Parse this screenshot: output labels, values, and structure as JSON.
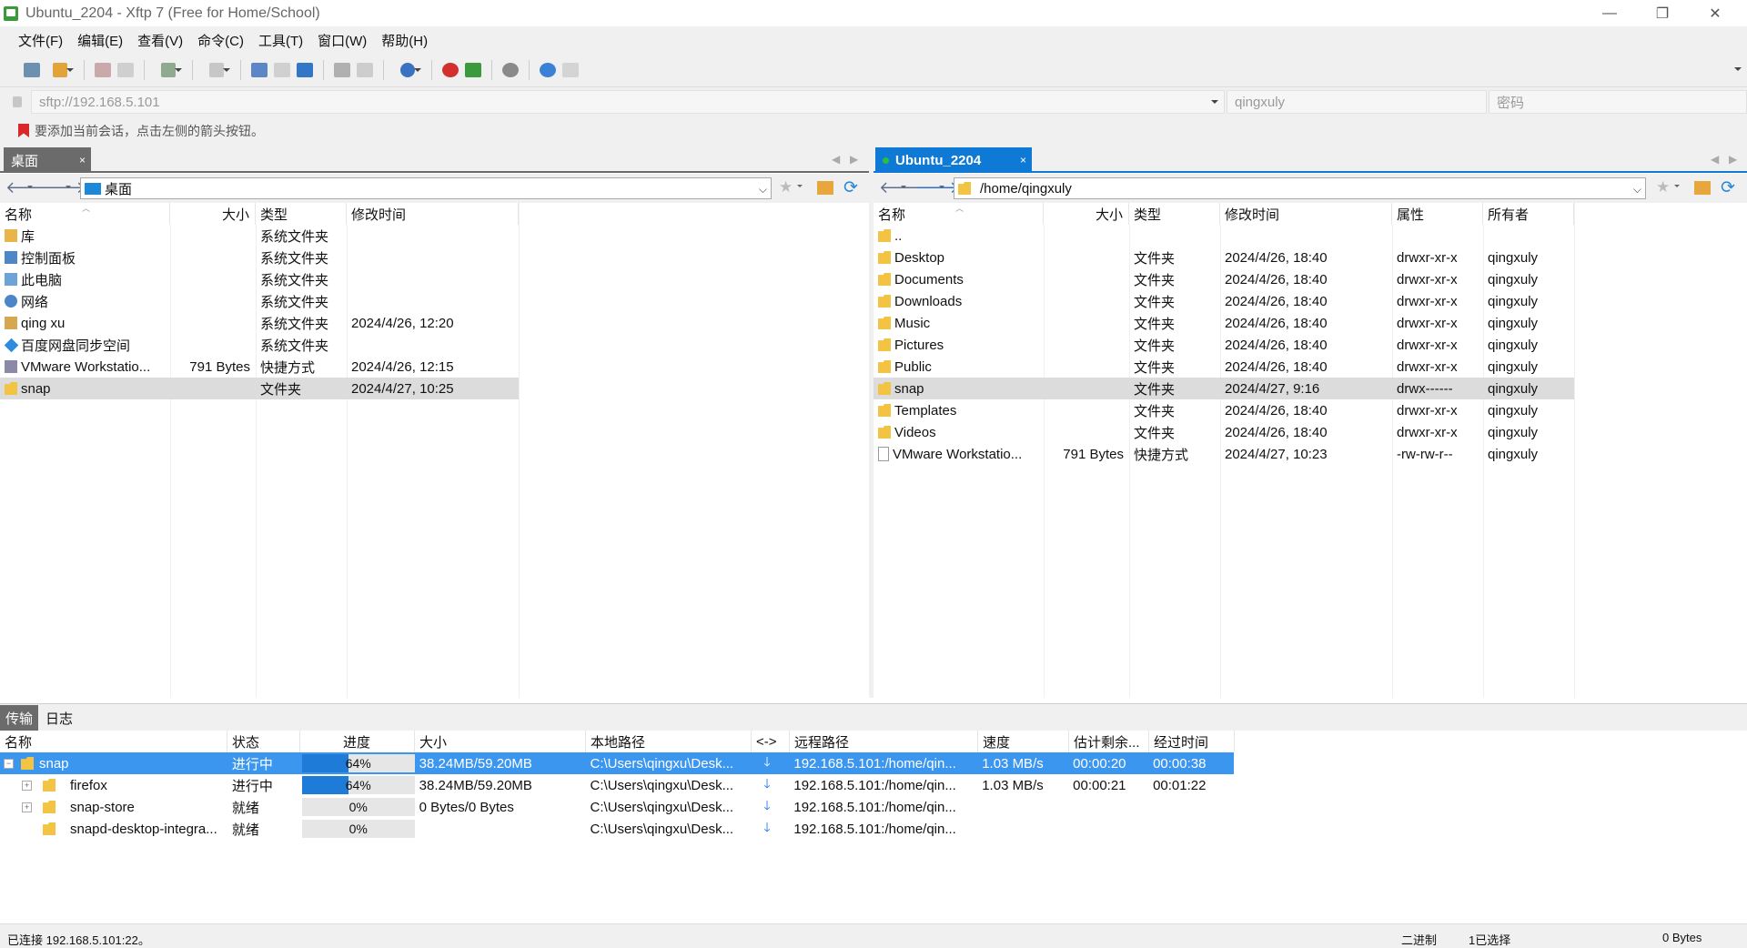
{
  "window": {
    "title": "Ubuntu_2204 - Xftp 7 (Free for Home/School)"
  },
  "menu": [
    "文件(F)",
    "编辑(E)",
    "查看(V)",
    "命令(C)",
    "工具(T)",
    "窗口(W)",
    "帮助(H)"
  ],
  "address": {
    "url": "sftp://192.168.5.101",
    "username": "qingxuly",
    "password_placeholder": "密码"
  },
  "hint": "要添加当前会话，点击左侧的箭头按钮。",
  "left_pane": {
    "tab": "桌面",
    "path": "桌面",
    "columns": [
      "名称",
      "大小",
      "类型",
      "修改时间"
    ],
    "rows": [
      {
        "name": "库",
        "size": "",
        "type": "系统文件夹",
        "modified": "",
        "icon": "library-icon"
      },
      {
        "name": "控制面板",
        "size": "",
        "type": "系统文件夹",
        "modified": "",
        "icon": "control-panel-icon"
      },
      {
        "name": "此电脑",
        "size": "",
        "type": "系统文件夹",
        "modified": "",
        "icon": "computer-icon"
      },
      {
        "name": "网络",
        "size": "",
        "type": "系统文件夹",
        "modified": "",
        "icon": "network-icon"
      },
      {
        "name": "qing xu",
        "size": "",
        "type": "系统文件夹",
        "modified": "2024/4/26, 12:20",
        "icon": "user-folder-icon"
      },
      {
        "name": "百度网盘同步空间",
        "size": "",
        "type": "系统文件夹",
        "modified": "",
        "icon": "baidu-netdisk-icon"
      },
      {
        "name": "VMware Workstatio...",
        "size": "791 Bytes",
        "type": "快捷方式",
        "modified": "2024/4/26, 12:15",
        "icon": "vmware-icon"
      },
      {
        "name": "snap",
        "size": "",
        "type": "文件夹",
        "modified": "2024/4/27, 10:25",
        "icon": "folder-icon"
      }
    ]
  },
  "right_pane": {
    "tab": "Ubuntu_2204",
    "path": "/home/qingxuly",
    "columns": [
      "名称",
      "大小",
      "类型",
      "修改时间",
      "属性",
      "所有者"
    ],
    "rows": [
      {
        "name": "..",
        "size": "",
        "type": "",
        "modified": "",
        "attr": "",
        "owner": "",
        "icon": "folder-icon"
      },
      {
        "name": "Desktop",
        "size": "",
        "type": "文件夹",
        "modified": "2024/4/26, 18:40",
        "attr": "drwxr-xr-x",
        "owner": "qingxuly",
        "icon": "folder-icon"
      },
      {
        "name": "Documents",
        "size": "",
        "type": "文件夹",
        "modified": "2024/4/26, 18:40",
        "attr": "drwxr-xr-x",
        "owner": "qingxuly",
        "icon": "folder-icon"
      },
      {
        "name": "Downloads",
        "size": "",
        "type": "文件夹",
        "modified": "2024/4/26, 18:40",
        "attr": "drwxr-xr-x",
        "owner": "qingxuly",
        "icon": "folder-icon"
      },
      {
        "name": "Music",
        "size": "",
        "type": "文件夹",
        "modified": "2024/4/26, 18:40",
        "attr": "drwxr-xr-x",
        "owner": "qingxuly",
        "icon": "folder-icon"
      },
      {
        "name": "Pictures",
        "size": "",
        "type": "文件夹",
        "modified": "2024/4/26, 18:40",
        "attr": "drwxr-xr-x",
        "owner": "qingxuly",
        "icon": "folder-icon"
      },
      {
        "name": "Public",
        "size": "",
        "type": "文件夹",
        "modified": "2024/4/26, 18:40",
        "attr": "drwxr-xr-x",
        "owner": "qingxuly",
        "icon": "folder-icon"
      },
      {
        "name": "snap",
        "size": "",
        "type": "文件夹",
        "modified": "2024/4/27, 9:16",
        "attr": "drwx------",
        "owner": "qingxuly",
        "icon": "folder-icon"
      },
      {
        "name": "Templates",
        "size": "",
        "type": "文件夹",
        "modified": "2024/4/26, 18:40",
        "attr": "drwxr-xr-x",
        "owner": "qingxuly",
        "icon": "folder-icon"
      },
      {
        "name": "Videos",
        "size": "",
        "type": "文件夹",
        "modified": "2024/4/26, 18:40",
        "attr": "drwxr-xr-x",
        "owner": "qingxuly",
        "icon": "folder-icon"
      },
      {
        "name": "VMware Workstatio...",
        "size": "791 Bytes",
        "type": "快捷方式",
        "modified": "2024/4/27, 10:23",
        "attr": "-rw-rw-r--",
        "owner": "qingxuly",
        "icon": "file-icon"
      }
    ]
  },
  "bottom": {
    "tabs": [
      "传输",
      "日志"
    ],
    "columns": [
      "名称",
      "状态",
      "进度",
      "大小",
      "本地路径",
      "<->",
      "远程路径",
      "速度",
      "估计剩余...",
      "经过时间"
    ],
    "rows": [
      {
        "name": "snap",
        "status": "进行中",
        "progress": 64,
        "progress_label": "64%",
        "size": "38.24MB/59.20MB",
        "local": "C:\\Users\\qingxu\\Desk...",
        "remote": "192.168.5.101:/home/qin...",
        "speed": "1.03 MB/s",
        "eta": "00:00:20",
        "elapsed": "00:00:38",
        "expander": "−"
      },
      {
        "name": "firefox",
        "status": "进行中",
        "progress": 64,
        "progress_label": "64%",
        "size": "38.24MB/59.20MB",
        "local": "C:\\Users\\qingxu\\Desk...",
        "remote": "192.168.5.101:/home/qin...",
        "speed": "1.03 MB/s",
        "eta": "00:00:21",
        "elapsed": "00:01:22",
        "expander": "+"
      },
      {
        "name": "snap-store",
        "status": "就绪",
        "progress": 0,
        "progress_label": "0%",
        "size": "0 Bytes/0 Bytes",
        "local": "C:\\Users\\qingxu\\Desk...",
        "remote": "192.168.5.101:/home/qin...",
        "speed": "",
        "eta": "",
        "elapsed": "",
        "expander": "+"
      },
      {
        "name": "snapd-desktop-integra...",
        "status": "就绪",
        "progress": 0,
        "progress_label": "0%",
        "size": "",
        "local": "C:\\Users\\qingxu\\Desk...",
        "remote": "192.168.5.101:/home/qin...",
        "speed": "",
        "eta": "",
        "elapsed": "",
        "expander": ""
      }
    ]
  },
  "status": {
    "connection": "已连接 192.168.5.101:22。",
    "mode": "二进制",
    "selection": "1已选择",
    "size": "0 Bytes"
  },
  "colors": {
    "accent": "#3b96f0",
    "active_tab": "#0f7ad6",
    "progress": "#1f7bd8",
    "folder": "#f3c443"
  }
}
